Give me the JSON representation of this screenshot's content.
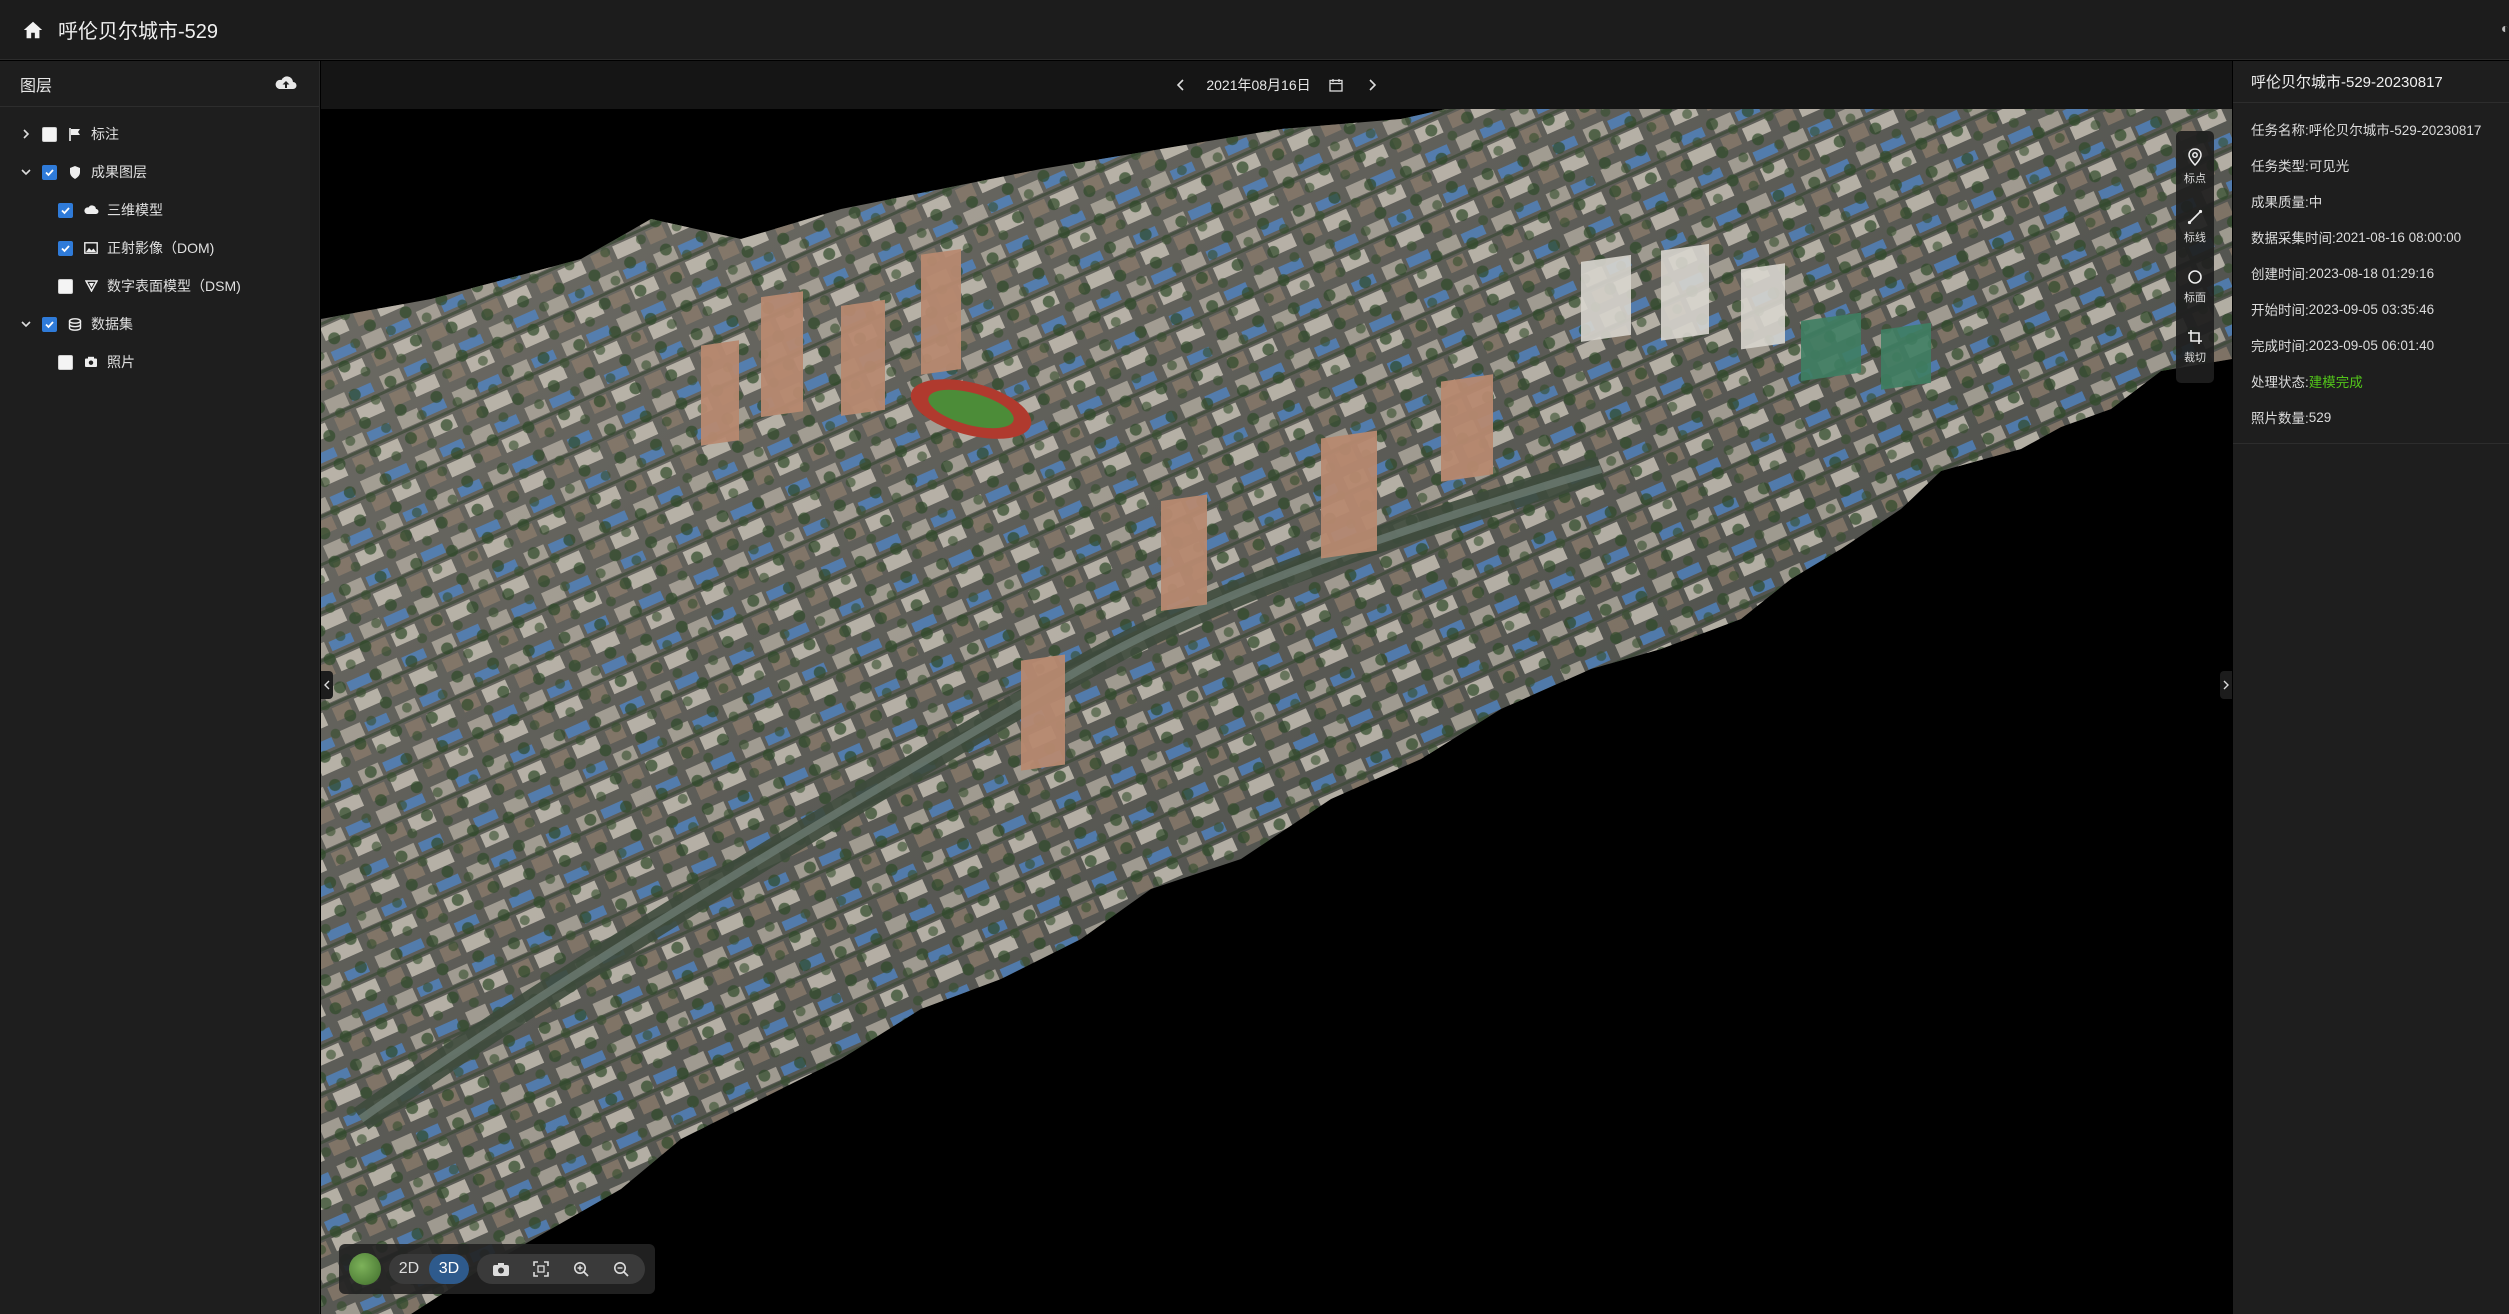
{
  "app": {
    "title": "呼伦贝尔城市-529"
  },
  "layers_panel": {
    "title": "图层",
    "tree": [
      {
        "label": "标注",
        "checked": false,
        "expanded": false,
        "icon": "flag-icon"
      },
      {
        "label": "成果图层",
        "checked": true,
        "expanded": true,
        "icon": "shield-icon",
        "children": [
          {
            "label": "三维模型",
            "checked": true,
            "icon": "cloud-model-icon"
          },
          {
            "label": "正射影像（DOM)",
            "checked": true,
            "icon": "image-icon"
          },
          {
            "label": "数字表面模型（DSM)",
            "checked": false,
            "icon": "triangle-down-icon"
          }
        ]
      },
      {
        "label": "数据集",
        "checked": true,
        "expanded": true,
        "icon": "dataset-icon",
        "children": [
          {
            "label": "照片",
            "checked": false,
            "icon": "photo-icon"
          }
        ]
      }
    ]
  },
  "viewer": {
    "date": "2021年08月16日",
    "measure_tools": [
      {
        "label": "标点",
        "icon": "location-pin-icon"
      },
      {
        "label": "标线",
        "icon": "line-ruler-icon"
      },
      {
        "label": "标面",
        "icon": "polygon-icon"
      },
      {
        "label": "裁切",
        "icon": "crop-icon"
      }
    ],
    "toolbar": {
      "mode_2d": "2D",
      "mode_3d": "3D",
      "active_mode": "3D"
    }
  },
  "info_panel": {
    "title": "呼伦贝尔城市-529-20230817",
    "rows": [
      {
        "label": "任务名称:",
        "value": "呼伦贝尔城市-529-20230817"
      },
      {
        "label": "任务类型:",
        "value": "可见光"
      },
      {
        "label": "成果质量:",
        "value": "中"
      },
      {
        "label": "数据采集时间:",
        "value": "2021-08-16 08:00:00"
      },
      {
        "label": "创建时间:",
        "value": "2023-08-18 01:29:16"
      },
      {
        "label": "开始时间:",
        "value": "2023-09-05 03:35:46"
      },
      {
        "label": "完成时间:",
        "value": "2023-09-05 06:01:40"
      },
      {
        "label": "处理状态:",
        "value": "建模完成",
        "status_color": "#52c41a"
      },
      {
        "label": "照片数量:",
        "value": "529"
      }
    ]
  },
  "colors": {
    "accent": "#2f7bd9",
    "success": "#52c41a",
    "panel_bg": "#1e1e1e"
  }
}
